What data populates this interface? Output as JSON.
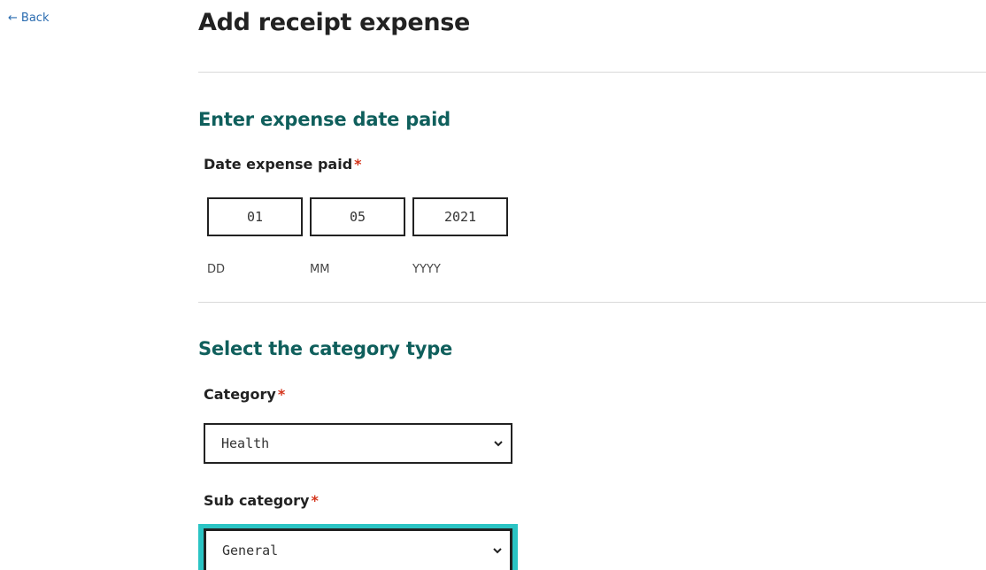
{
  "nav": {
    "back_arrow": "←",
    "back_label": "Back"
  },
  "page": {
    "title": "Add receipt expense"
  },
  "date_section": {
    "heading": "Enter expense date paid",
    "field_label": "Date expense paid",
    "required_mark": "*",
    "day": {
      "value": "01",
      "hint": "DD"
    },
    "month": {
      "value": "05",
      "hint": "MM"
    },
    "year": {
      "value": "2021",
      "hint": "YYYY"
    }
  },
  "category_section": {
    "heading": "Select the category type",
    "category": {
      "label": "Category",
      "required_mark": "*",
      "selected": "Health"
    },
    "sub_category": {
      "label": "Sub category",
      "required_mark": "*",
      "selected": "General"
    }
  },
  "colors": {
    "heading_teal": "#0f5f5c",
    "focus_ring": "#2bc4c4",
    "required_red": "#d4351c",
    "link_blue": "#2b6cb0"
  },
  "icons": {
    "back": "arrow-left-icon",
    "select": "chevron-down-icon"
  }
}
